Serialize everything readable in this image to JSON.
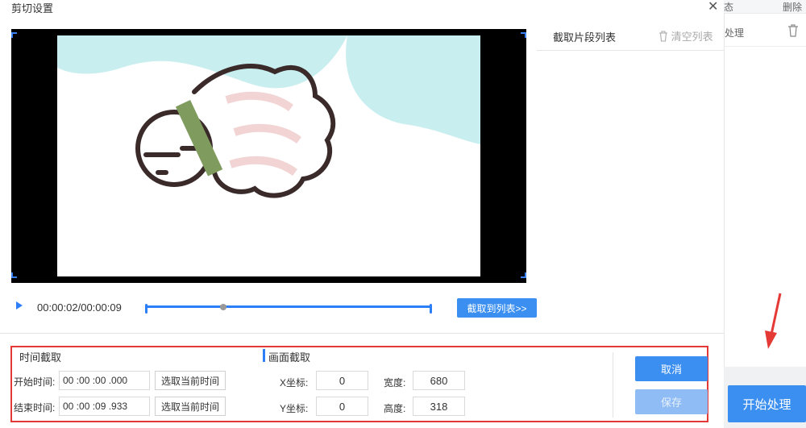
{
  "dialog": {
    "title": "剪切设置",
    "close_glyph": "✕"
  },
  "background": {
    "header_status": "态",
    "header_delete": "删除",
    "row_status": "处理",
    "start_button": "开始处理"
  },
  "segment_list": {
    "title": "截取片段列表",
    "clear_label": "清空列表"
  },
  "player": {
    "time_display": "00:00:02/00:00:09",
    "progress_fraction": 0.27,
    "cut_to_list_label": "截取到列表>>"
  },
  "time_crop": {
    "title": "时间截取",
    "start_label": "开始时间:",
    "start_value": "00 :00 :00 .000",
    "end_label": "结束时间:",
    "end_value": "00 :00 :09 .933",
    "pick_current_label": "选取当前时间"
  },
  "frame_crop": {
    "title": "画面截取",
    "x_label": "X坐标:",
    "x_value": "0",
    "y_label": "Y坐标:",
    "y_value": "0",
    "width_label": "宽度:",
    "width_value": "680",
    "height_label": "高度:",
    "height_value": "318"
  },
  "actions": {
    "cancel_label": "取消",
    "save_label": "保存"
  },
  "colors": {
    "accent": "#3b8ff0",
    "highlight_box": "#e53935",
    "arrow": "#e53935"
  }
}
